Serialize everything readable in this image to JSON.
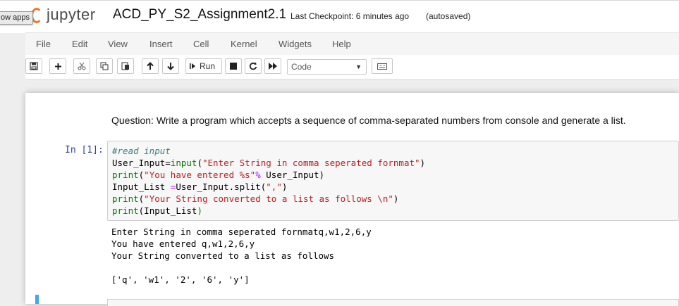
{
  "overlay": {
    "show_apps_label": "ow apps"
  },
  "header": {
    "logo_text": "jupyter",
    "notebook_title": "ACD_PY_S2_Assignment2.1",
    "checkpoint": "Last Checkpoint: 6 minutes ago",
    "autosave_status": "(autosaved)"
  },
  "menubar": {
    "items": [
      "File",
      "Edit",
      "View",
      "Insert",
      "Cell",
      "Kernel",
      "Widgets",
      "Help"
    ]
  },
  "toolbar": {
    "buttons": [
      "save-icon",
      "add-cell-icon",
      "cut-icon",
      "copy-icon",
      "paste-icon",
      "move-up-icon",
      "move-down-icon",
      "run-icon",
      "stop-icon",
      "restart-icon",
      "fast-forward-icon",
      "keyboard-icon"
    ],
    "run_label": "Run",
    "cell_type": "Code"
  },
  "cells": {
    "markdown_text": "Question: Write a program which accepts a sequence of comma-separated numbers from console and generate a list.",
    "code_prompt": "In [1]:",
    "code": {
      "line1_comment": "#read input",
      "line2_a": "User_Input=",
      "line2_b": "input",
      "line2_c": "(",
      "line2_d": "\"Enter String in comma seperated fornmat\"",
      "line2_e": ")",
      "line3_a": "print",
      "line3_b": "(",
      "line3_c": "\"You have entered %s\"",
      "line3_d": "%",
      "line3_e": " User_Input)",
      "line4_a": "Input_List ",
      "line4_b": "=",
      "line4_c": "User_Input.split(",
      "line4_d": "\",\"",
      "line4_e": ")",
      "line5_a": "print",
      "line5_b": "(",
      "line5_c": "\"Your String converted to a list as follows \\n\"",
      "line5_d": ")",
      "line6_a": "print",
      "line6_b": "(",
      "line6_c": "Input_List",
      "line6_d": ")"
    },
    "output": [
      "Enter String in comma seperated fornmatq,w1,2,6,y",
      "You have entered q,w1,2,6,y",
      "Your String converted to a list as follows",
      "",
      "['q', 'w1', '2', '6', 'y']"
    ]
  },
  "colors": {
    "accent_orange": "#f37726",
    "prompt_blue": "#303f9f",
    "selected_cell_blue": "#42a5f5"
  }
}
